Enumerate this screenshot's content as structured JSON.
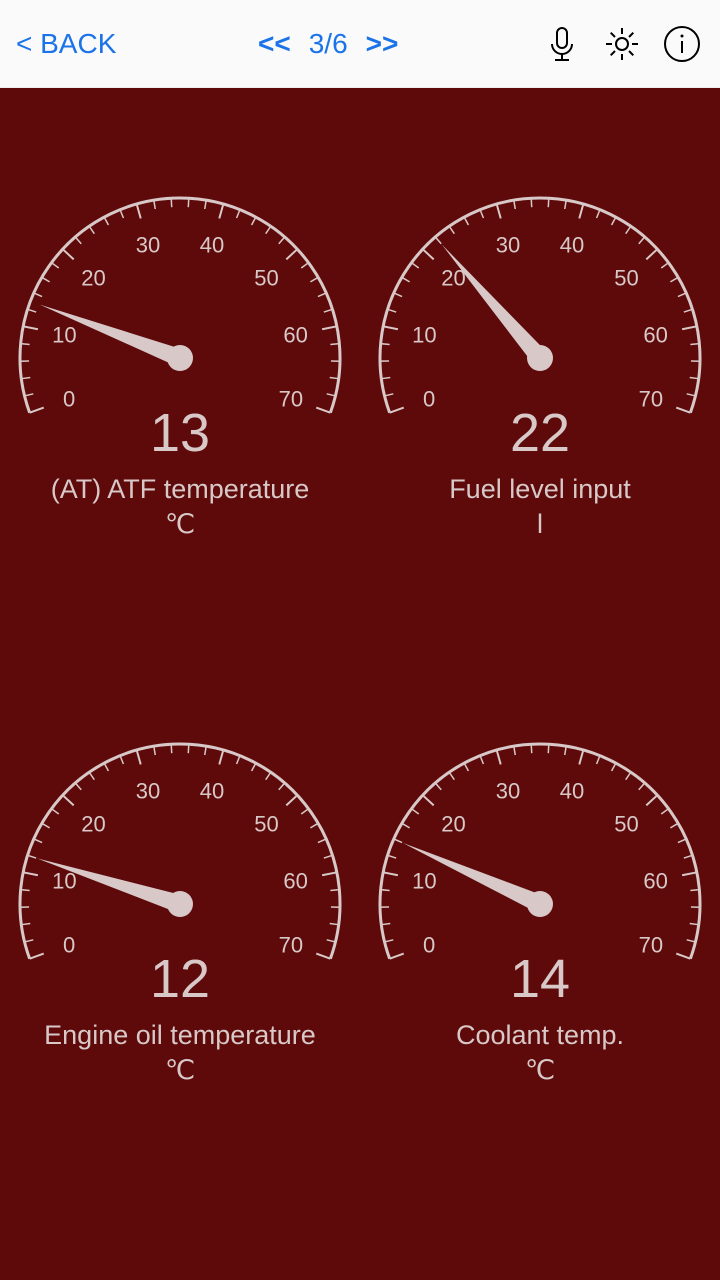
{
  "header": {
    "back_label": "< BACK",
    "prev_arrow": "<<",
    "page_indicator": "3/6",
    "next_arrow": ">>"
  },
  "gauges": [
    {
      "value": "13",
      "label": "(AT) ATF temperature",
      "unit": "℃",
      "min": 0,
      "max": 70,
      "ticks": [
        "0",
        "10",
        "20",
        "30",
        "40",
        "50",
        "60",
        "70"
      ]
    },
    {
      "value": "22",
      "label": "Fuel level input",
      "unit": "l",
      "min": 0,
      "max": 70,
      "ticks": [
        "0",
        "10",
        "20",
        "30",
        "40",
        "50",
        "60",
        "70"
      ]
    },
    {
      "value": "12",
      "label": "Engine oil temperature",
      "unit": "℃",
      "min": 0,
      "max": 70,
      "ticks": [
        "0",
        "10",
        "20",
        "30",
        "40",
        "50",
        "60",
        "70"
      ]
    },
    {
      "value": "14",
      "label": "Coolant temp.",
      "unit": "℃",
      "min": 0,
      "max": 70,
      "ticks": [
        "0",
        "10",
        "20",
        "30",
        "40",
        "50",
        "60",
        "70"
      ]
    }
  ]
}
